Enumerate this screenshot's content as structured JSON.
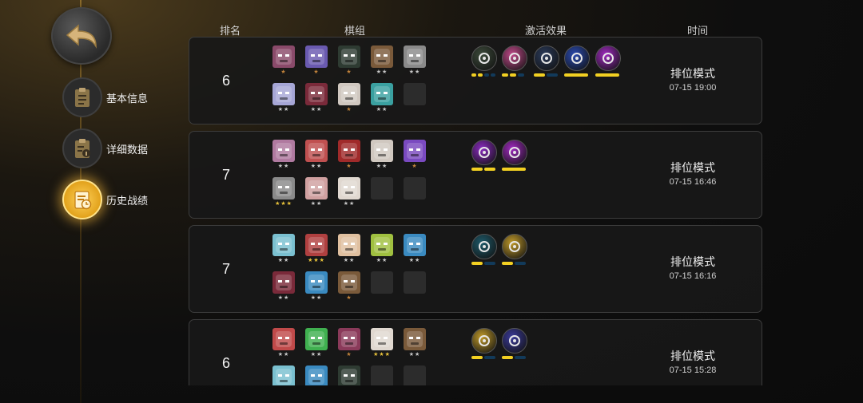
{
  "nav": {
    "back_icon": "back-arrow-icon",
    "items": [
      {
        "label": "基本信息",
        "icon": "clipboard-icon",
        "active": false
      },
      {
        "label": "详细数据",
        "icon": "clipboard-info-icon",
        "active": false
      },
      {
        "label": "历史战绩",
        "icon": "history-clock-icon",
        "active": true
      }
    ]
  },
  "table": {
    "headers": {
      "rank": "排名",
      "lineup": "棋组",
      "traits": "激活效果",
      "time": "时间"
    },
    "rows": [
      {
        "rank": "6",
        "mode": "排位模式",
        "time": "07-15 19:00",
        "units": [
          {
            "stars": 1,
            "color": "#8a4a6a"
          },
          {
            "stars": 1,
            "color": "#6a5ab0"
          },
          {
            "stars": 1,
            "color": "#2e3b32"
          },
          {
            "stars": 2,
            "color": "#7a5a3a"
          },
          {
            "stars": 2,
            "color": "#8a8a8a"
          },
          {
            "stars": 2,
            "color": "#a6a6d6"
          },
          {
            "stars": 2,
            "color": "#7a2a3a"
          },
          {
            "stars": 1,
            "color": "#d0c8c0"
          },
          {
            "stars": 2,
            "color": "#3aa0a0"
          },
          {
            "stars": 0,
            "color": ""
          }
        ],
        "traits": [
          {
            "icon": "eye-circle-icon",
            "color": "#3c4a3a",
            "bars": [
              1,
              1,
              0,
              0
            ]
          },
          {
            "icon": "knight-icon",
            "color": "#c04a8a",
            "bars": [
              1,
              1,
              0
            ]
          },
          {
            "icon": "shuriken-icon",
            "color": "#2a3a5a",
            "bars": [
              1,
              0
            ]
          },
          {
            "icon": "lightning-icon",
            "color": "#2a4ab0",
            "bars": [
              1
            ]
          },
          {
            "icon": "skull-icon",
            "color": "#a02ac0",
            "bars": [
              1
            ]
          }
        ]
      },
      {
        "rank": "7",
        "mode": "排位模式",
        "time": "07-15 16:46",
        "units": [
          {
            "stars": 2,
            "color": "#b07aa0"
          },
          {
            "stars": 2,
            "color": "#c05050"
          },
          {
            "stars": 1,
            "color": "#a02a2a"
          },
          {
            "stars": 2,
            "color": "#d0c8c0"
          },
          {
            "stars": 1,
            "color": "#7a4ac0"
          },
          {
            "stars": 3,
            "color": "#8a8a8a"
          },
          {
            "stars": 2,
            "color": "#d0a0a0"
          },
          {
            "stars": 2,
            "color": "#e0d8d0"
          },
          {
            "stars": 0,
            "color": ""
          },
          {
            "stars": 0,
            "color": ""
          }
        ],
        "traits": [
          {
            "icon": "face-circle-icon",
            "color": "#8a2ac0",
            "bars": [
              1,
              1
            ]
          },
          {
            "icon": "skull-icon",
            "color": "#a02ac0",
            "bars": [
              1
            ]
          }
        ]
      },
      {
        "rank": "7",
        "mode": "排位模式",
        "time": "07-15 16:16",
        "units": [
          {
            "stars": 2,
            "color": "#7ac0d0"
          },
          {
            "stars": 3,
            "color": "#b04040"
          },
          {
            "stars": 2,
            "color": "#e0c0a0"
          },
          {
            "stars": 2,
            "color": "#a0c040"
          },
          {
            "stars": 2,
            "color": "#3a8ac0"
          },
          {
            "stars": 2,
            "color": "#7a2a3a"
          },
          {
            "stars": 2,
            "color": "#3a8ac0"
          },
          {
            "stars": 1,
            "color": "#7a5a3a"
          },
          {
            "stars": 0,
            "color": ""
          },
          {
            "stars": 0,
            "color": ""
          }
        ],
        "traits": [
          {
            "icon": "question-circle-icon",
            "color": "#1e5a6a",
            "bars": [
              1,
              0
            ]
          },
          {
            "icon": "keyhole-icon",
            "color": "#c09a2a",
            "bars": [
              1,
              0
            ]
          }
        ]
      },
      {
        "rank": "6",
        "mode": "排位模式",
        "time": "07-15 15:28",
        "units": [
          {
            "stars": 2,
            "color": "#c04a4a"
          },
          {
            "stars": 2,
            "color": "#40b050"
          },
          {
            "stars": 1,
            "color": "#8a3a5a"
          },
          {
            "stars": 3,
            "color": "#e0d8d0"
          },
          {
            "stars": 2,
            "color": "#7a5a3a"
          },
          {
            "stars": 2,
            "color": "#7ac0d0"
          },
          {
            "stars": 2,
            "color": "#3a8ac0"
          },
          {
            "stars": 2,
            "color": "#2e3b32"
          },
          {
            "stars": 0,
            "color": ""
          },
          {
            "stars": 0,
            "color": ""
          }
        ],
        "traits": [
          {
            "icon": "keyhole-icon",
            "color": "#c09a2a",
            "bars": [
              1,
              0
            ]
          },
          {
            "icon": "panel-icon",
            "color": "#3a3a9a",
            "bars": [
              1,
              0
            ]
          }
        ]
      }
    ]
  }
}
